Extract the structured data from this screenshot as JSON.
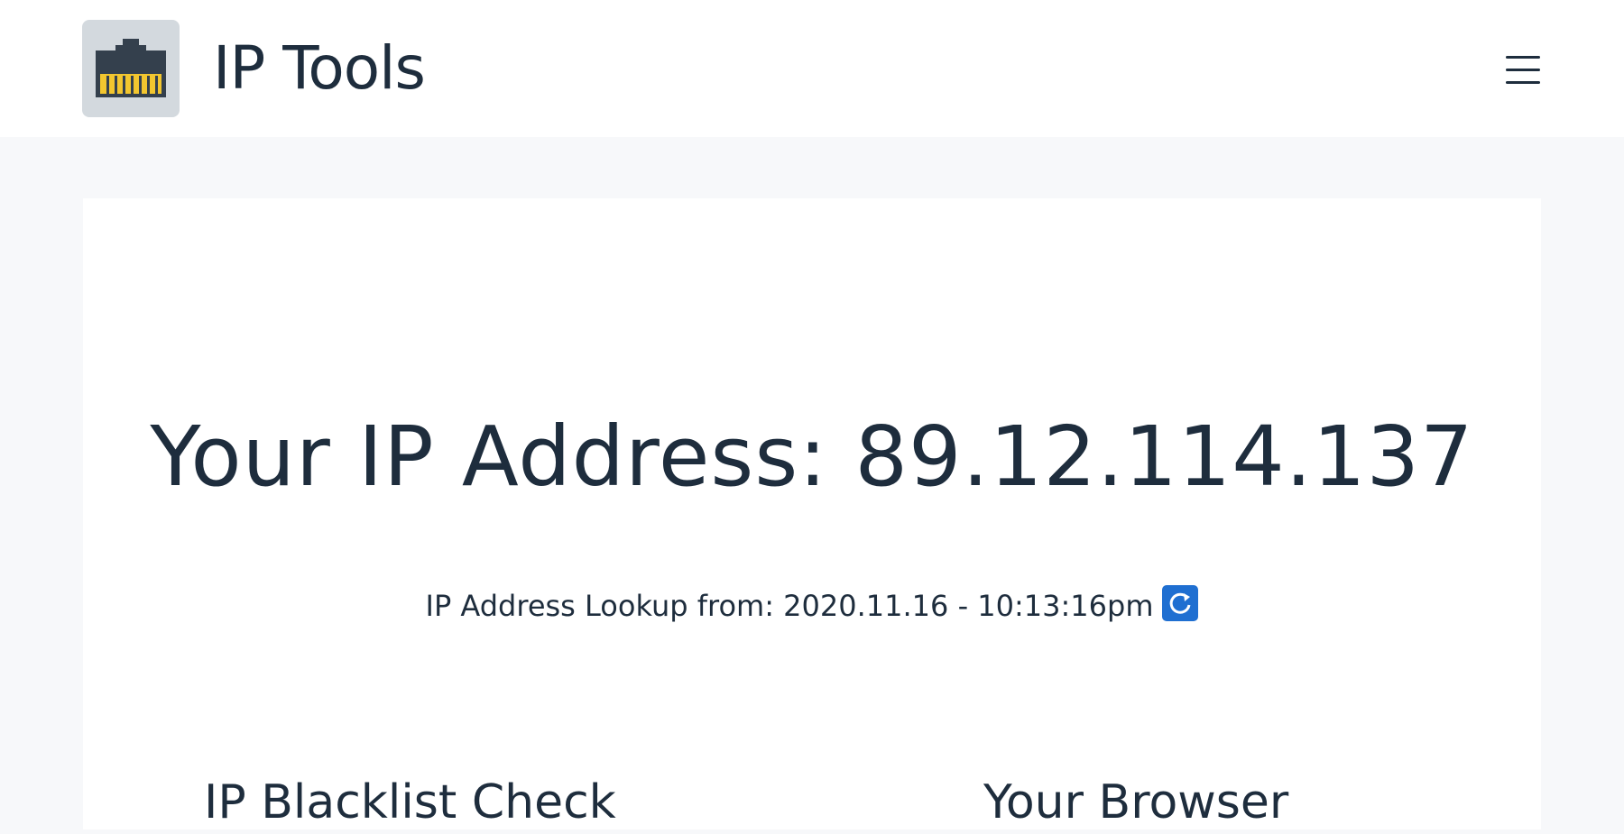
{
  "header": {
    "logo_icon": "ethernet-port-icon",
    "brand": "IP Tools",
    "menu_icon": "hamburger-menu-icon"
  },
  "main": {
    "ip_heading": "Your IP Address: 89.12.114.137",
    "lookup_text": "IP Address Lookup from: 2020.11.16 - 10:13:16pm",
    "refresh_icon": "refresh-icon",
    "sections": [
      {
        "title": "IP Blacklist Check"
      },
      {
        "title": "Your Browser"
      }
    ]
  },
  "colors": {
    "text": "#1e2d3d",
    "page_bg": "#f7f8fa",
    "logo_bg": "#d3d9de",
    "logo_port": "#34404d",
    "logo_pins": "#f2c62f",
    "refresh_bg": "#1f6fd1"
  }
}
